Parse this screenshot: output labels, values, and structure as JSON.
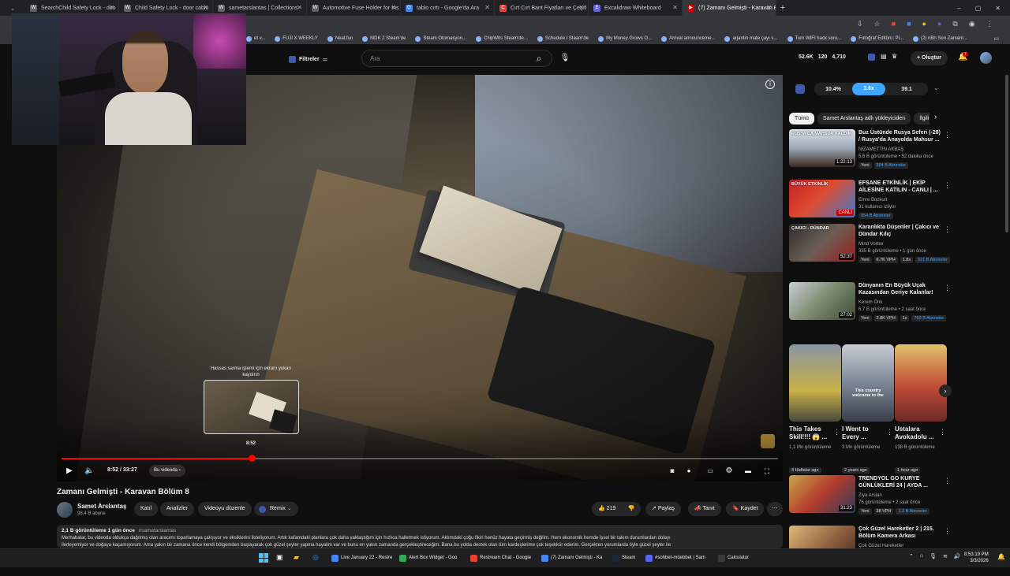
{
  "browser": {
    "tabs": [
      {
        "label": "SearchChild Safety Lock - doo",
        "icon": "W"
      },
      {
        "label": "Child Safety Lock - door cabin",
        "icon": "W"
      },
      {
        "label": "sametarslantas | Collections - ",
        "icon": "W"
      },
      {
        "label": "Automotive Fuse Holder for Ins",
        "icon": "W"
      },
      {
        "label": "tablo cırtı - Google'da Ara",
        "icon": "G"
      },
      {
        "label": "Cırt Cırt Bant Fiyatları ve Çeşitl",
        "icon": "C"
      },
      {
        "label": "Excalidraw Whiteboard",
        "icon": "E"
      },
      {
        "label": "(7) Zamanı Gelmişti - Karavan B",
        "icon": "▶"
      }
    ],
    "new_tab": "+",
    "bookmarks": [
      "et v...",
      "FUJI X WEEKLY",
      "Neal.fun",
      "MDK 2 Steam'de",
      "Steam Otomasyon...",
      "ChipWits Steam'de...",
      "Schedule I Steam'de",
      "My Money Grows O...",
      "Arrival announceme...",
      "arjantin mate çayı s...",
      "Tum WIFI hack soru...",
      "Fotoğraf Editörü: Pi...",
      "(2) nBn Son Zamanl..."
    ]
  },
  "header": {
    "filters_label": "Filtreler",
    "search_placeholder": "Ara",
    "stats": [
      "52.6K",
      "120",
      "4,710"
    ],
    "create_label": "Oluştur",
    "notification_count": "7"
  },
  "player": {
    "current_time": "8:52",
    "duration": "33:27",
    "time_display": "8:52 / 33:27",
    "chapter_label": "Bu videoda",
    "progress_fraction": 0.265,
    "seek_hint": "Hassas sarma işlemi için ekranı yukarı kaydırın",
    "preview_time": "8:52"
  },
  "video": {
    "title": "Zamanı Gelmişti - Karavan Bölüm 8",
    "channel": "Samet Arslantaş",
    "subscribers": "98,4 B abone",
    "join_label": "Katıl",
    "analytics_label": "Analizler",
    "edit_label": "Videoyu düzenle",
    "remix_label": "Remix",
    "likes": "219",
    "share_label": "Paylaş",
    "promote_label": "Tanıt",
    "save_label": "Kaydet",
    "views_line": "2,1 B görüntüleme  1 gün önce",
    "hashtag": "#sametarslantas",
    "description_1": "Merhabalar, bu videoda oldukça dağılmış olan aracımı toparlamaya çalışıyor ve eksiklerini listeliyorum. Artık kafamdaki planlara çok daha yaklaştığım için hızlıca halletmek istiyorum. Aklımdaki çoğu fikiri henüz hayata geçirmiş değilim. Hem ekonomik hemde işsel bir takım durumlardan dolayı",
    "description_2": "ilerleyemiyor ve doğaya kaçamıyorum. Ama yakın bir zamana önce kendi bölgemden başlayarak çok güzel şeyler yapma hayalim var ve bunu en yakın zamanda gerçekleştireceğim. Bana bu yolda destek olan tüm kardeşlerime çok teşekkür ederim. Gerçekten yorumlarda öyle güzel şeyler ile"
  },
  "sidebar": {
    "stats": [
      "10.4%",
      "3.6x",
      "39.1"
    ],
    "chips": [
      "Tümü",
      "Samet Arslantaş adlı yükleyiciden",
      "İlgili"
    ],
    "videos": [
      {
        "title": "Buz Üstünde Rusya Seferi (-28) / Rusya'da Anayolda Mahsur ...",
        "channel": "NİZAMETTİN AKBAŞ",
        "meta": "5,6 B görüntüleme • 52 dakika önce",
        "duration": "1:22:13",
        "badges": [
          "Yeni",
          "304 B Aboneler"
        ],
        "thumb_text": "RUSYA'DA MAHSUR KALDIM"
      },
      {
        "title": "EFSANE ETKİNLİK | EKİP AİLESİNE KATILIN - CANLI | ...",
        "channel": "Emre Bozkurt",
        "meta": "31 kullanıcı izliyor",
        "duration": "CANLI",
        "badges": [
          "954 B Aboneler"
        ],
        "thumb_text": "BÜYÜK ETKİNLİK"
      },
      {
        "title": "Karanlıkta Düşenler | Çakıcı ve Dündar Kılıç",
        "channel": "Mind Vortex",
        "meta": "335 B görüntüleme • 1 gün önce",
        "duration": "52:37",
        "badges": [
          "Yeni",
          "6.7K VPH",
          "1.8x",
          "521 B Aboneler"
        ],
        "thumb_text": "ÇAKICI - DÜNDAR"
      },
      {
        "title": "Dünyanın En Büyük Uçak Kazasından Geriye Kalanlar!",
        "channel": "Kerem Önk",
        "meta": "6,7 B görüntüleme • 2 saat önce",
        "duration": "27:02",
        "badges": [
          "Yeni",
          "2.8K VPH",
          "1x",
          "769 B Aboneler"
        ],
        "thumb_text": ""
      }
    ],
    "shorts": [
      {
        "title": "This Takes Skill!!!! 😱 ...",
        "views": "1,1 Mn görüntüleme",
        "badge": "4 Haftalar ago"
      },
      {
        "title": "I Went to Every ...",
        "views": "3 Mn görüntüleme",
        "badge": "2 years ago",
        "thumb_text": "This country welcome to the"
      },
      {
        "title": "Ustalara Avokadolu ...",
        "views": "138 B görüntüleme",
        "badge": "1 hour ago"
      }
    ],
    "more_videos": [
      {
        "title": "TRENDYOL GO KURYE GÜNLÜKLERİ 24 | AYDA ...",
        "channel": "Ziya Arslan",
        "meta": "76 görüntüleme • 2 saat önce",
        "duration": "31:23",
        "badges": [
          "Yeni",
          "38 VPH",
          "1.2 B Aboneler"
        ]
      },
      {
        "title": "Çok Güzel Hareketler 2 | 215. Bölüm Kamera Arkası",
        "channel": "Çok Güzel Hareketler",
        "meta": "",
        "duration": "",
        "badges": []
      }
    ]
  },
  "taskbar": {
    "apps": [
      "Live January 22 - Restre",
      "Alert Box Widget - Goo",
      "Restream Chat - Google",
      "(7) Zamanı Gelmişti - Ka",
      "Steam",
      "#sohbet-müebbet | Sam",
      "Calculator"
    ],
    "time": "8:53:19 PM",
    "date": "3/3/2026"
  },
  "colors": {
    "accent_red": "#ff0000",
    "accent_blue": "#3ea6ff",
    "bg": "#0f0f0f"
  }
}
